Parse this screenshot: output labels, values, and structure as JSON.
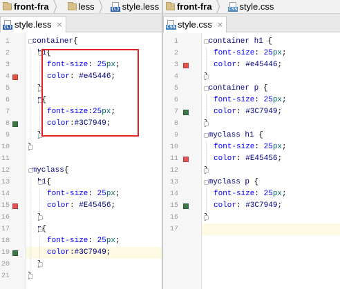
{
  "left_pane": {
    "breadcrumb": [
      {
        "label": "front-fra",
        "icon": "folder-icon",
        "bold": true
      },
      {
        "label": "less",
        "icon": "folder-icon",
        "bold": false
      },
      {
        "label": "style.less",
        "icon": "less-file-icon",
        "bold": false
      }
    ],
    "tab": {
      "label": "style.less",
      "icon": "less-file-icon",
      "close": "×"
    },
    "lines": [
      {
        "n": "1",
        "indent": 0,
        "tokens": [
          {
            "t": ".container",
            "c": "t-sel"
          },
          {
            "t": "{",
            "c": ""
          }
        ]
      },
      {
        "n": "2",
        "indent": 1,
        "tokens": [
          {
            "t": "h1",
            "c": "t-sel"
          },
          {
            "t": "{",
            "c": ""
          }
        ]
      },
      {
        "n": "3",
        "indent": 2,
        "tokens": [
          {
            "t": "font-size",
            "c": "t-prop"
          },
          {
            "t": ": ",
            "c": ""
          },
          {
            "t": "25",
            "c": "t-num"
          },
          {
            "t": "px",
            "c": "t-unit"
          },
          {
            "t": ";",
            "c": ""
          }
        ]
      },
      {
        "n": "4",
        "indent": 2,
        "tokens": [
          {
            "t": "color",
            "c": "t-prop"
          },
          {
            "t": ": ",
            "c": ""
          },
          {
            "t": "#e45446",
            "c": "t-val"
          },
          {
            "t": ";",
            "c": ""
          }
        ],
        "swatch": "#e45446"
      },
      {
        "n": "5",
        "indent": 1,
        "tokens": [
          {
            "t": "}",
            "c": ""
          }
        ]
      },
      {
        "n": "6",
        "indent": 1,
        "tokens": [
          {
            "t": "p",
            "c": "t-sel"
          },
          {
            "t": "{",
            "c": ""
          }
        ]
      },
      {
        "n": "7",
        "indent": 2,
        "tokens": [
          {
            "t": "font-size",
            "c": "t-prop"
          },
          {
            "t": ":",
            "c": ""
          },
          {
            "t": "25",
            "c": "t-num"
          },
          {
            "t": "px",
            "c": "t-unit"
          },
          {
            "t": ";",
            "c": ""
          }
        ]
      },
      {
        "n": "8",
        "indent": 2,
        "tokens": [
          {
            "t": "color",
            "c": "t-prop"
          },
          {
            "t": ":",
            "c": ""
          },
          {
            "t": "#3C7949",
            "c": "t-val"
          },
          {
            "t": ";",
            "c": ""
          }
        ],
        "swatch": "#3C7949"
      },
      {
        "n": "9",
        "indent": 1,
        "tokens": [
          {
            "t": "}",
            "c": ""
          }
        ]
      },
      {
        "n": "10",
        "indent": 0,
        "tokens": [
          {
            "t": "}",
            "c": ""
          }
        ]
      },
      {
        "n": "11",
        "indent": 0,
        "tokens": []
      },
      {
        "n": "12",
        "indent": 0,
        "tokens": [
          {
            "t": ".myclass",
            "c": "t-sel"
          },
          {
            "t": "{",
            "c": ""
          }
        ]
      },
      {
        "n": "13",
        "indent": 1,
        "tokens": [
          {
            "t": "h1",
            "c": "t-sel"
          },
          {
            "t": "{",
            "c": ""
          }
        ]
      },
      {
        "n": "14",
        "indent": 2,
        "tokens": [
          {
            "t": "font-size",
            "c": "t-prop"
          },
          {
            "t": ": ",
            "c": ""
          },
          {
            "t": "25",
            "c": "t-num"
          },
          {
            "t": "px",
            "c": "t-unit"
          },
          {
            "t": ";",
            "c": ""
          }
        ]
      },
      {
        "n": "15",
        "indent": 2,
        "tokens": [
          {
            "t": "color",
            "c": "t-prop"
          },
          {
            "t": ": ",
            "c": ""
          },
          {
            "t": "#E45456",
            "c": "t-val"
          },
          {
            "t": ";",
            "c": ""
          }
        ],
        "swatch": "#E45456"
      },
      {
        "n": "16",
        "indent": 1,
        "tokens": [
          {
            "t": "}",
            "c": ""
          }
        ]
      },
      {
        "n": "17",
        "indent": 1,
        "tokens": [
          {
            "t": "p",
            "c": "t-sel"
          },
          {
            "t": "{",
            "c": ""
          }
        ]
      },
      {
        "n": "18",
        "indent": 2,
        "tokens": [
          {
            "t": "font-size",
            "c": "t-prop"
          },
          {
            "t": ": ",
            "c": ""
          },
          {
            "t": "25",
            "c": "t-num"
          },
          {
            "t": "px",
            "c": "t-unit"
          },
          {
            "t": ";",
            "c": ""
          }
        ]
      },
      {
        "n": "19",
        "indent": 2,
        "tokens": [
          {
            "t": "color",
            "c": "t-prop"
          },
          {
            "t": ":",
            "c": ""
          },
          {
            "t": "#3C7949",
            "c": "t-val"
          },
          {
            "t": ";",
            "c": ""
          }
        ],
        "swatch": "#3C7949",
        "highlight": true
      },
      {
        "n": "20",
        "indent": 1,
        "tokens": [
          {
            "t": "}",
            "c": ""
          }
        ]
      },
      {
        "n": "21",
        "indent": 0,
        "tokens": [
          {
            "t": "}",
            "c": ""
          }
        ]
      }
    ]
  },
  "right_pane": {
    "breadcrumb": [
      {
        "label": "front-fra",
        "icon": "folder-icon",
        "bold": true
      },
      {
        "label": "style.css",
        "icon": "css-file-icon",
        "bold": false
      }
    ],
    "tab": {
      "label": "style.css",
      "icon": "css-file-icon",
      "close": "×"
    },
    "lines": [
      {
        "n": "1",
        "indent": 0,
        "tokens": [
          {
            "t": ".container h1",
            "c": "t-sel"
          },
          {
            "t": " {",
            "c": ""
          }
        ]
      },
      {
        "n": "2",
        "indent": 1,
        "tokens": [
          {
            "t": "font-size",
            "c": "t-prop"
          },
          {
            "t": ": ",
            "c": ""
          },
          {
            "t": "25",
            "c": "t-num"
          },
          {
            "t": "px",
            "c": "t-unit"
          },
          {
            "t": ";",
            "c": ""
          }
        ]
      },
      {
        "n": "3",
        "indent": 1,
        "tokens": [
          {
            "t": "color",
            "c": "t-prop"
          },
          {
            "t": ": ",
            "c": ""
          },
          {
            "t": "#e45446",
            "c": "t-val"
          },
          {
            "t": ";",
            "c": ""
          }
        ],
        "swatch": "#e45446"
      },
      {
        "n": "4",
        "indent": 0,
        "tokens": [
          {
            "t": "}",
            "c": ""
          }
        ]
      },
      {
        "n": "5",
        "indent": 0,
        "tokens": [
          {
            "t": ".container p",
            "c": "t-sel"
          },
          {
            "t": " {",
            "c": ""
          }
        ]
      },
      {
        "n": "6",
        "indent": 1,
        "tokens": [
          {
            "t": "font-size",
            "c": "t-prop"
          },
          {
            "t": ": ",
            "c": ""
          },
          {
            "t": "25",
            "c": "t-num"
          },
          {
            "t": "px",
            "c": "t-unit"
          },
          {
            "t": ";",
            "c": ""
          }
        ]
      },
      {
        "n": "7",
        "indent": 1,
        "tokens": [
          {
            "t": "color",
            "c": "t-prop"
          },
          {
            "t": ": ",
            "c": ""
          },
          {
            "t": "#3C7949",
            "c": "t-val"
          },
          {
            "t": ";",
            "c": ""
          }
        ],
        "swatch": "#3C7949"
      },
      {
        "n": "8",
        "indent": 0,
        "tokens": [
          {
            "t": "}",
            "c": ""
          }
        ]
      },
      {
        "n": "9",
        "indent": 0,
        "tokens": [
          {
            "t": ".myclass h1",
            "c": "t-sel"
          },
          {
            "t": " {",
            "c": ""
          }
        ]
      },
      {
        "n": "10",
        "indent": 1,
        "tokens": [
          {
            "t": "font-size",
            "c": "t-prop"
          },
          {
            "t": ": ",
            "c": ""
          },
          {
            "t": "25",
            "c": "t-num"
          },
          {
            "t": "px",
            "c": "t-unit"
          },
          {
            "t": ";",
            "c": ""
          }
        ]
      },
      {
        "n": "11",
        "indent": 1,
        "tokens": [
          {
            "t": "color",
            "c": "t-prop"
          },
          {
            "t": ": ",
            "c": ""
          },
          {
            "t": "#E45456",
            "c": "t-val"
          },
          {
            "t": ";",
            "c": ""
          }
        ],
        "swatch": "#E45456"
      },
      {
        "n": "12",
        "indent": 0,
        "tokens": [
          {
            "t": "}",
            "c": ""
          }
        ]
      },
      {
        "n": "13",
        "indent": 0,
        "tokens": [
          {
            "t": ".myclass p",
            "c": "t-sel"
          },
          {
            "t": " {",
            "c": ""
          }
        ]
      },
      {
        "n": "14",
        "indent": 1,
        "tokens": [
          {
            "t": "font-size",
            "c": "t-prop"
          },
          {
            "t": ": ",
            "c": ""
          },
          {
            "t": "25",
            "c": "t-num"
          },
          {
            "t": "px",
            "c": "t-unit"
          },
          {
            "t": ";",
            "c": ""
          }
        ]
      },
      {
        "n": "15",
        "indent": 1,
        "tokens": [
          {
            "t": "color",
            "c": "t-prop"
          },
          {
            "t": ": ",
            "c": ""
          },
          {
            "t": "#3C7949",
            "c": "t-val"
          },
          {
            "t": ";",
            "c": ""
          }
        ],
        "swatch": "#3C7949"
      },
      {
        "n": "16",
        "indent": 0,
        "tokens": [
          {
            "t": "}",
            "c": ""
          }
        ]
      },
      {
        "n": "17",
        "indent": 0,
        "tokens": [],
        "highlight": true
      }
    ]
  }
}
